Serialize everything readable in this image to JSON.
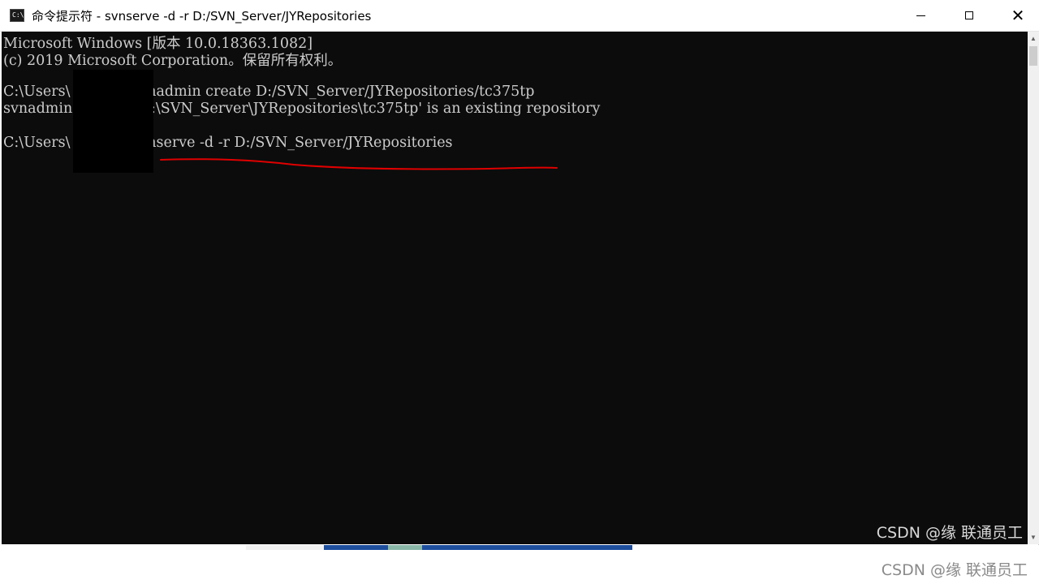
{
  "window": {
    "title": "命令提示符 - svnserve  -d -r D:/SVN_Server/JYRepositories",
    "icon": "cmd-icon",
    "controls": {
      "minimize": "minimize-icon",
      "maximize": "maximize-icon",
      "close": "close-icon"
    }
  },
  "console": {
    "background": "#0c0c0c",
    "foreground": "#cccccc",
    "annotation_color": "#e00000",
    "lines": {
      "l1": "Microsoft Windows [版本 10.0.18363.1082]",
      "l2": "(c) 2019 Microsoft Corporation。保留所有权利。",
      "l4": "C:\\Users\\           >svnadmin create D:/SVN_Server/JYRepositories/tc375tp",
      "l5": "svnadmin              'D:\\SVN_Server\\JYRepositories\\tc375tp' is an existing repository",
      "l7": "C:\\Users\\           >svnserve -d -r D:/SVN_Server/JYRepositories"
    },
    "watermark": "CSDN @缘   联通员工"
  },
  "page_watermark": "CSDN @缘   联通员工"
}
